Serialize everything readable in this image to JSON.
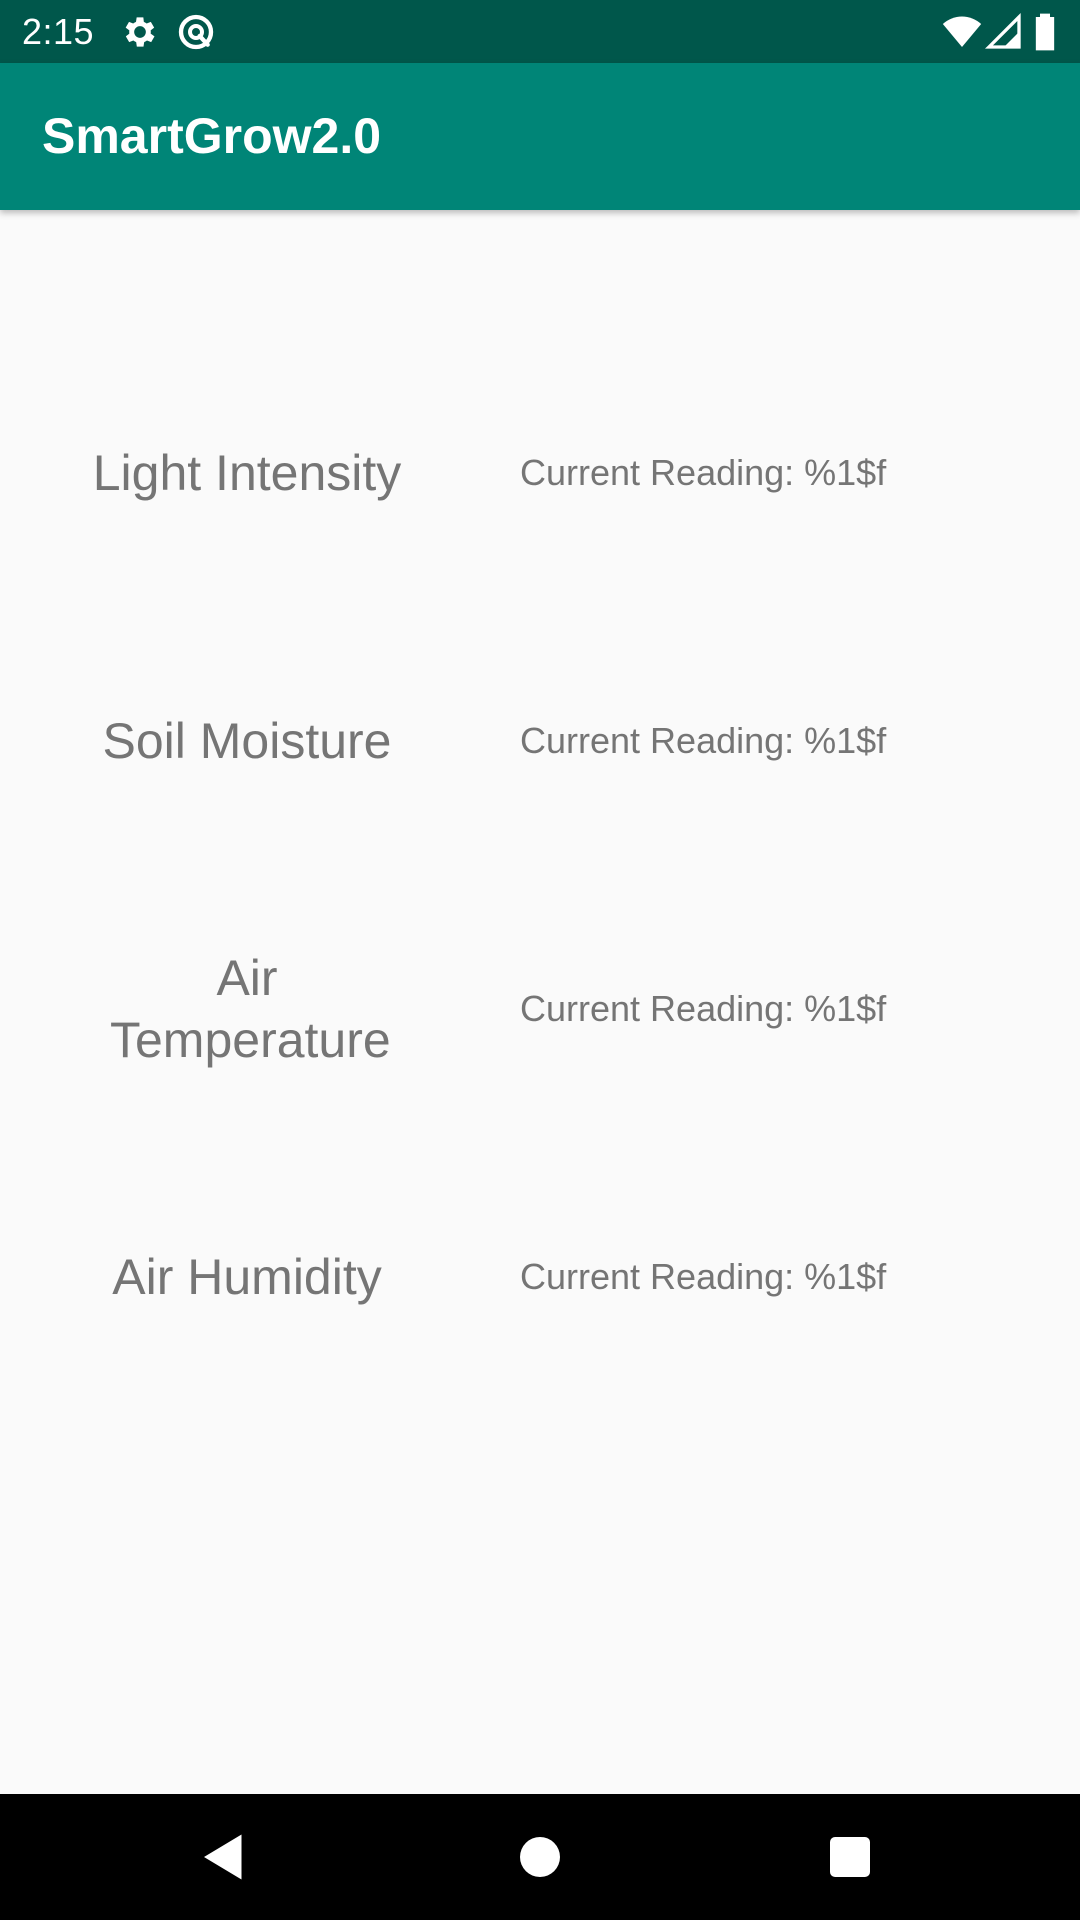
{
  "status_bar": {
    "time": "2:15",
    "icons": [
      "gear-icon",
      "vpn-circle-icon",
      "wifi-icon",
      "signal-icon",
      "battery-icon"
    ],
    "background": "#00574b"
  },
  "app_bar": {
    "title": "SmartGrow2.0",
    "background": "#008577"
  },
  "sensors": [
    {
      "label": "Light Intensity",
      "reading": "Current Reading: %1$f"
    },
    {
      "label": "Soil Moisture",
      "reading": "Current Reading: %1$f"
    },
    {
      "label": "Air Temperature",
      "reading": "Current Reading: %1$f"
    },
    {
      "label": "Air Humidity",
      "reading": "Current Reading: %1$f"
    }
  ],
  "nav_bar": {
    "buttons": [
      "back-icon",
      "home-icon",
      "recents-icon"
    ]
  }
}
